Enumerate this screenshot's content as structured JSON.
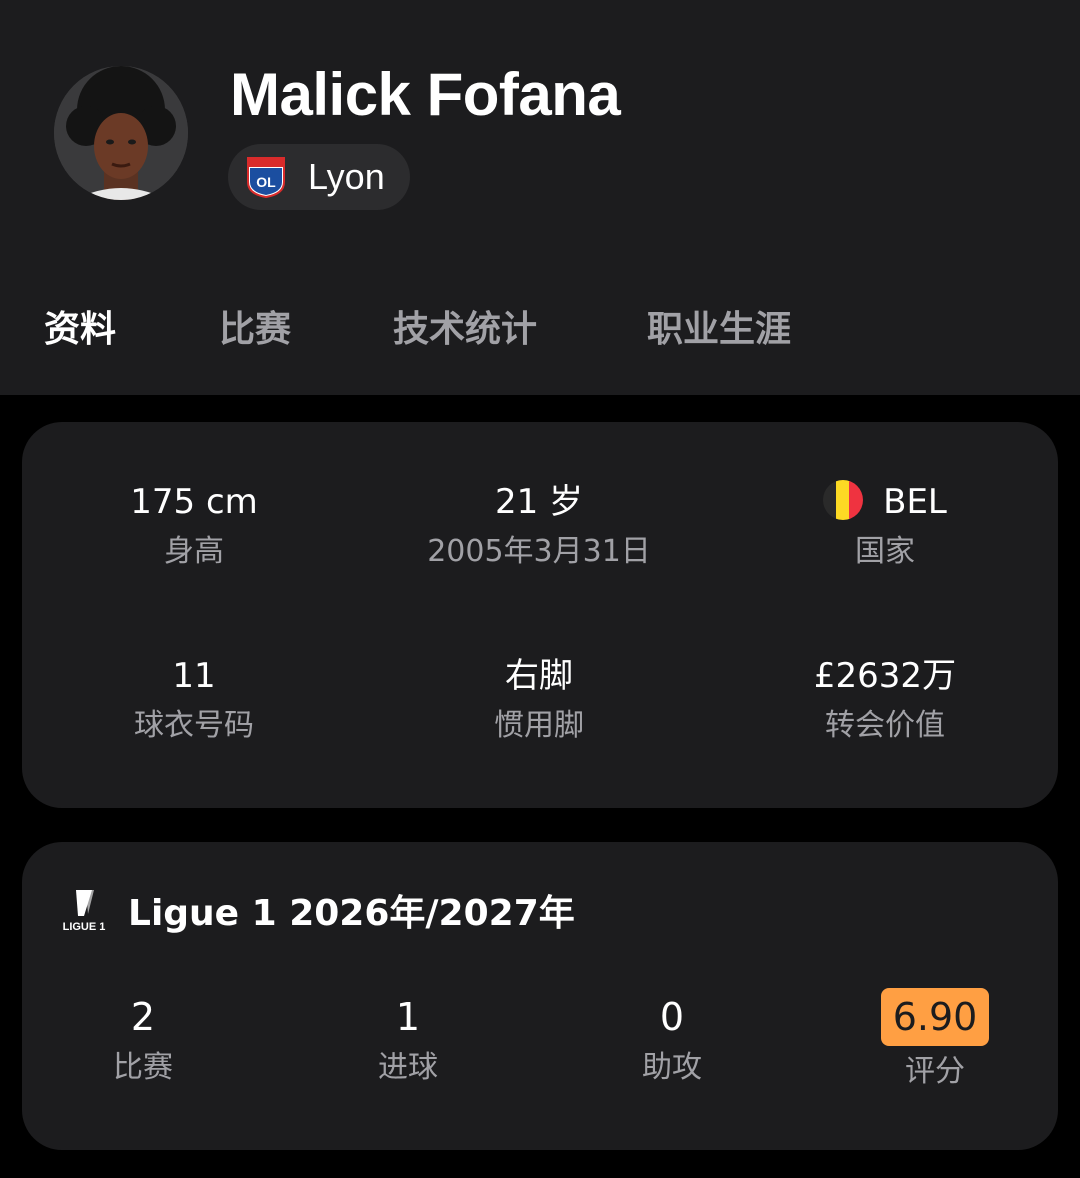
{
  "player": {
    "name": "Malick Fofana",
    "team": "Lyon"
  },
  "tabs": [
    {
      "label": "资料",
      "active": true
    },
    {
      "label": "比赛",
      "active": false
    },
    {
      "label": "技术统计",
      "active": false
    },
    {
      "label": "职业生涯",
      "active": false
    }
  ],
  "profile": {
    "height": {
      "value": "175 cm",
      "label": "身高"
    },
    "age": {
      "value": "21 岁",
      "label": "2005年3月31日"
    },
    "country": {
      "value": "BEL",
      "label": "国家",
      "flag": "belgium-flag-icon"
    },
    "jersey": {
      "value": "11",
      "label": "球衣号码"
    },
    "foot": {
      "value": "右脚",
      "label": "惯用脚"
    },
    "market_value": {
      "value": "£2632万",
      "label": "转会价值"
    }
  },
  "season": {
    "league_logo_text": "LIGUE 1",
    "title": "Ligue 1 2026年/2027年",
    "stats": [
      {
        "value": "2",
        "label": "比赛"
      },
      {
        "value": "1",
        "label": "进球"
      },
      {
        "value": "0",
        "label": "助攻"
      },
      {
        "value": "6.90",
        "label": "评分"
      }
    ]
  },
  "colors": {
    "background": "#000000",
    "surface": "#1c1c1e",
    "muted_text": "#a1a1a6",
    "rating_badge": "#ff9f43"
  }
}
